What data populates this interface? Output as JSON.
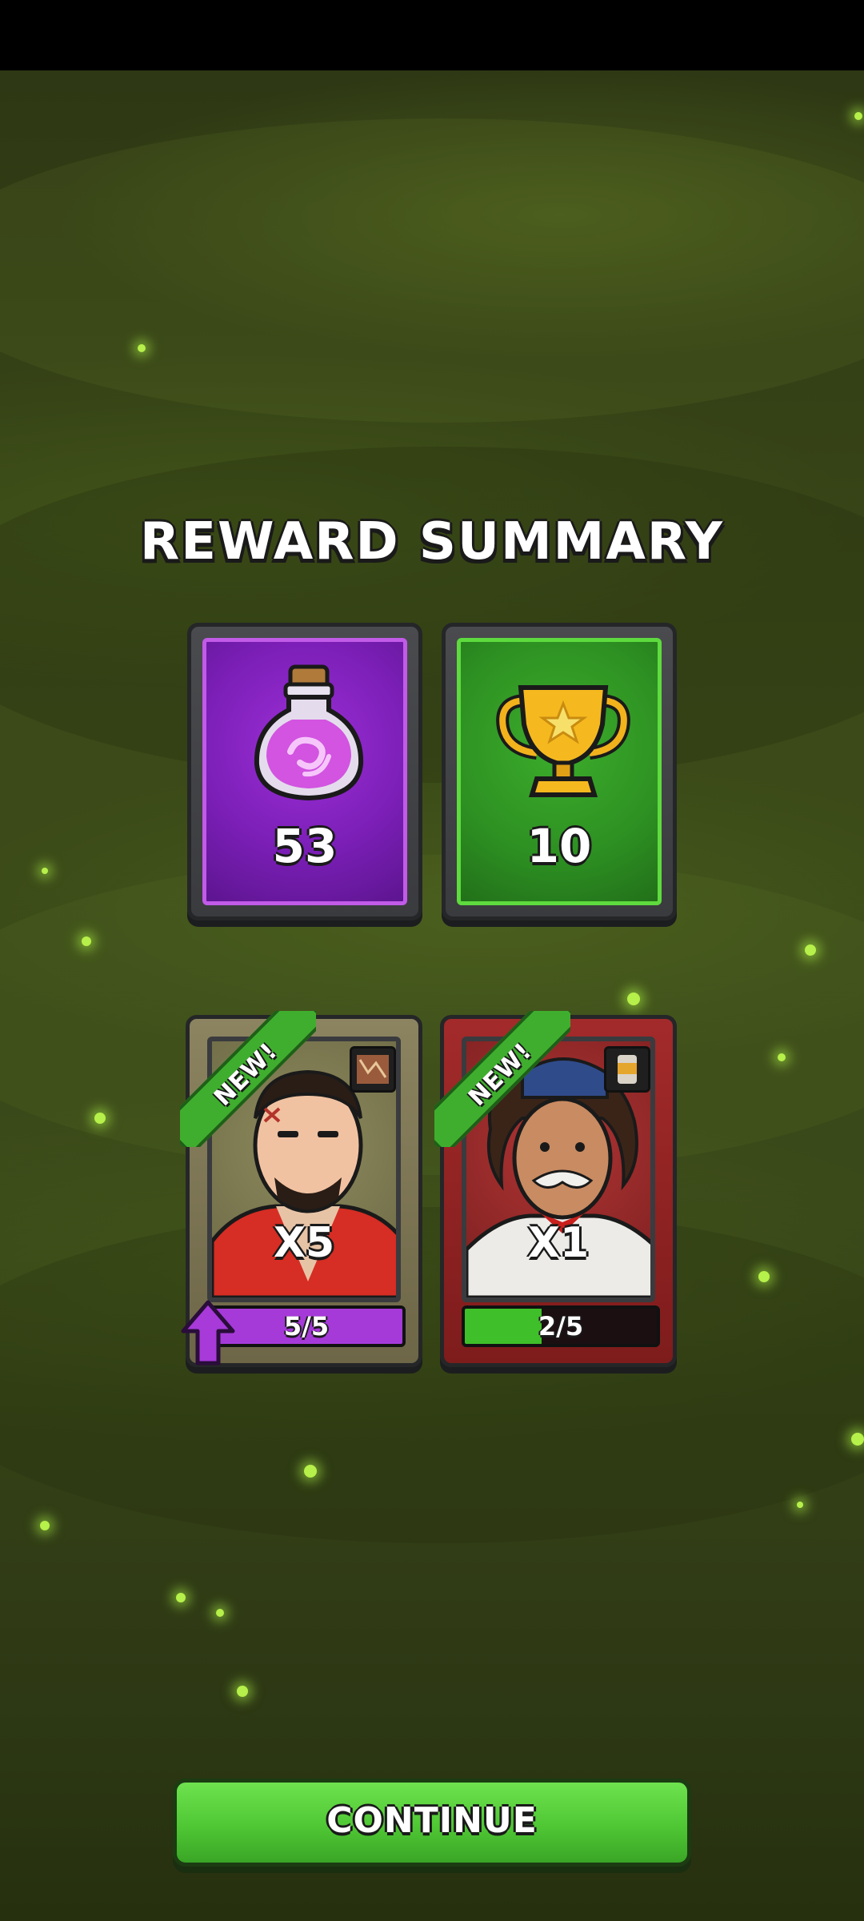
{
  "header": {
    "title": "REWARD SUMMARY"
  },
  "rewards": [
    {
      "icon": "potion-icon",
      "amount": "53",
      "color": "#7c1fb8"
    },
    {
      "icon": "trophy-icon",
      "amount": "10",
      "color": "#2d9022"
    }
  ],
  "heroes": [
    {
      "badge": "NEW!",
      "multiplier": "X5",
      "progress_text": "5/5",
      "progress": 1.0,
      "bar_color": "#a53ad8",
      "frame": "tan",
      "item_icon": "map-icon",
      "upgrade_available": true
    },
    {
      "badge": "NEW!",
      "multiplier": "X1",
      "progress_text": "2/5",
      "progress": 0.4,
      "bar_color": "#3fbf2a",
      "frame": "red",
      "item_icon": "can-icon",
      "upgrade_available": false
    }
  ],
  "footer": {
    "continue_label": "CONTINUE"
  }
}
